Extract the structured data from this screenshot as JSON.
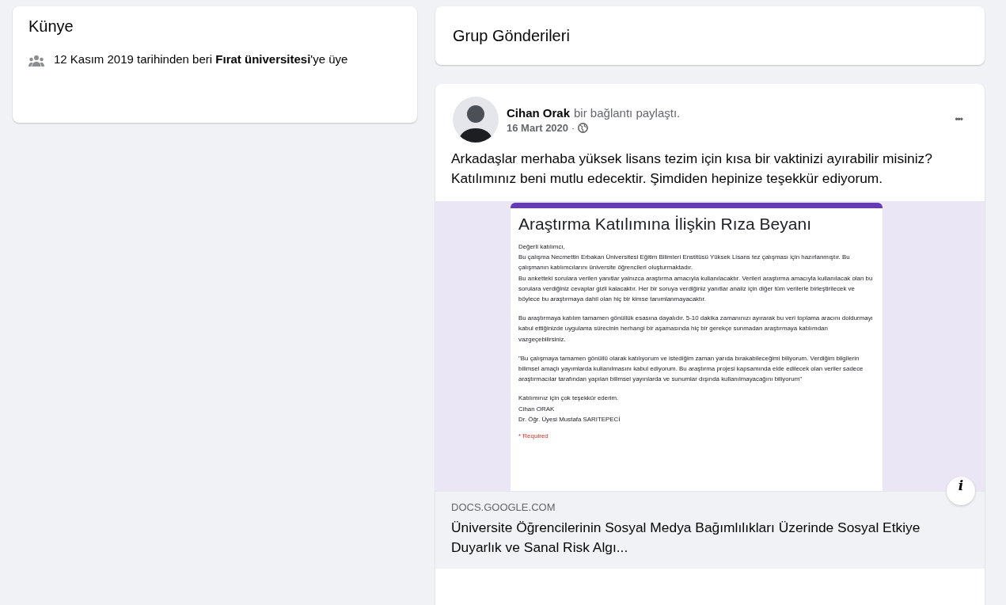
{
  "about_card": {
    "title": "Künye",
    "membership": "12 Kasım 2019 tarihinden beri **Fırat üniversitesi**'ye üye"
  },
  "posts_header": {
    "title": "Grup Gönderileri"
  },
  "post": {
    "author": "Cihan Orak",
    "action": "bir bağlantı paylaştı.",
    "date": "16 Mart 2020",
    "separator": "·",
    "more": "•••",
    "text": "Arkadaşlar merhaba yüksek lisans tezim için kısa bir vaktinizi ayırabilir misiniz? Katılımınız beni mutlu edecektir. Şimdiden hepinize teşekkür ediyorum.",
    "preview": {
      "form_title": "Araştırma Katılımına İlişkin Rıza Beyanı",
      "paragraphs": [
        "Değerli katılımcı,",
        "Bu çalışma Necmettin Erbakan Üniversitesi Eğitim Bilimleri Enstitüsü Yüksek Lisans tez çalışması için hazırlanmıştır. Bu çalışmanın katılımcılarını üniversite öğrencileri oluşturmaktadır.",
        "Bu anketteki sorulara verilen yanıtlar yalnızca araştırma amacıyla kullanılacaktır. Verileri araştırma amacıyla kullanılacak olan bu sorulara verdiğiniz cevaplar gizli kalacaktır. Her bir soruya verdiğiniz yanıtlar analiz için diğer tüm verilerle birleştirilecek ve böylece bu araştırmaya dahil olan hiç bir kimse tanımlanmayacaktır.",
        "Bu araştırmaya katılım tamamen gönüllük esasına dayalıdır. 5-10 dakika zamanınızı ayırarak bu veri toplama aracını doldurmayı kabul ettiğinizde uygulama sürecinin herhangi bir aşamasında hiç bir gerekçe sunmadan araştırmaya katılımdan vazgeçebilirsiniz.",
        "\"Bu çalışmaya tamamen gönüllü olarak katılıyorum ve istediğim zaman yarıda bırakabileceğimi biliyorum. Verdiğim bilgilerin bilimsel amaçlı yayımlarda kullanılmasını kabul ediyorum. Bu araştırma projesi kapsamında elde edilecek olan veriler sadece araştırmacılar tarafından yapılan bilimsel yayınlarda ve sunumlar dışında kullanılmayacağını biliyorum\"",
        "Katılımınız için çok teşekkür ederim.",
        "Cihan ORAK",
        "Dr. Öğr. Üyesi Mustafa SARITEPECİ"
      ],
      "required": "* Required",
      "info": "i"
    },
    "link": {
      "domain": "DOCS.GOOGLE.COM",
      "title": "Üniversite Öğrencilerinin Sosyal Medya Bağımlılıkları Üzerinde Sosyal Etkiye Duyarlık ve Sanal Risk Algı..."
    }
  }
}
